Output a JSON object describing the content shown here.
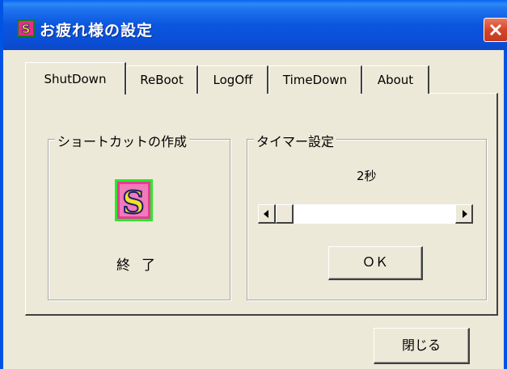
{
  "window": {
    "title": "お疲れ様の設定",
    "close_glyph": "✕"
  },
  "tabs": [
    {
      "label": "ShutDown",
      "active": true
    },
    {
      "label": "ReBoot",
      "active": false
    },
    {
      "label": "LogOff",
      "active": false
    },
    {
      "label": "TimeDown",
      "active": false
    },
    {
      "label": "About",
      "active": false
    }
  ],
  "shortcut_group": {
    "title": "ショートカットの作成",
    "icon": "shutdown-app-icon",
    "icon_letter": "S",
    "label": "終了"
  },
  "timer_group": {
    "title": "タイマー設定",
    "value": "2秒",
    "slider_level": 0,
    "ok_label": "ＯＫ"
  },
  "footer": {
    "close_label": "閉じる"
  },
  "colors": {
    "titlebar": "#0A4FD8",
    "face": "#ECE9D8",
    "close_red": "#D5452A"
  }
}
